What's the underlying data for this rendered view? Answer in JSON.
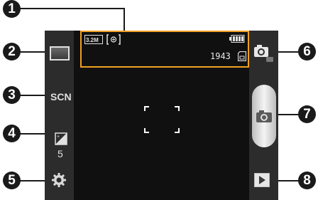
{
  "callouts": [
    "1",
    "2",
    "3",
    "4",
    "5",
    "6",
    "7",
    "8"
  ],
  "status": {
    "resolution": "3.2M",
    "storage_count": "1943"
  },
  "left_toolbar": {
    "scene_label": "SCN",
    "exposure_value": "5"
  },
  "icons": [
    "resolution-icon",
    "stabilizer-icon",
    "battery-icon",
    "memory-card-icon",
    "shooting-mode-icon",
    "exposure-icon",
    "settings-gear-icon",
    "switch-camera-icon",
    "shutter-camera-icon",
    "play-icon"
  ]
}
